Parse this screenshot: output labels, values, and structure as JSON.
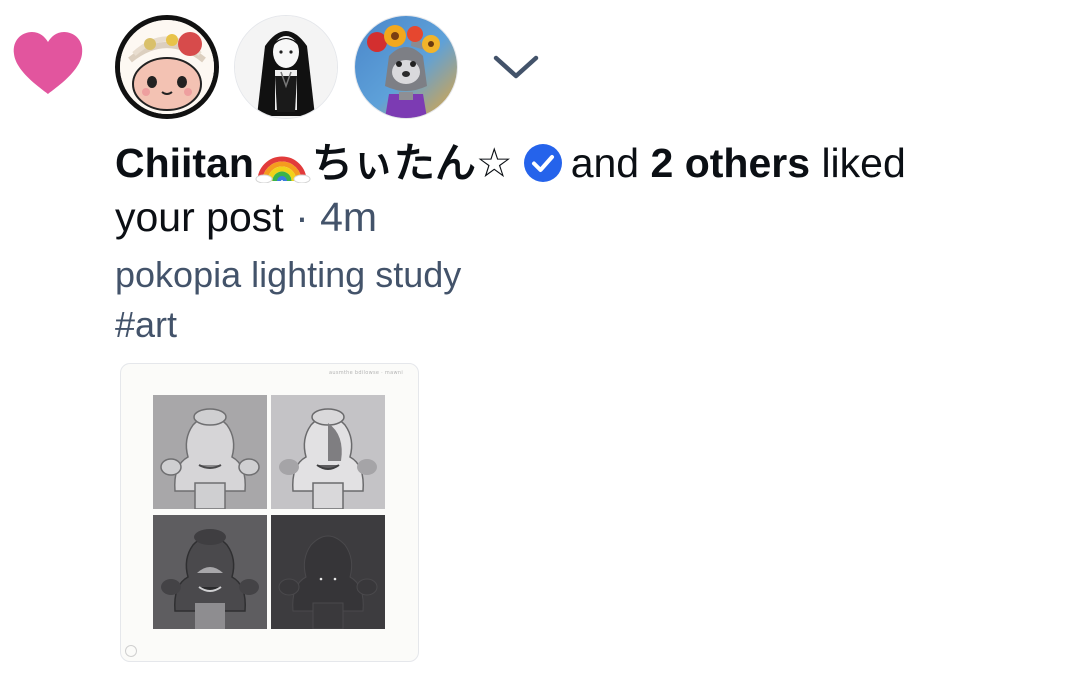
{
  "notification": {
    "type_icon": "heart-icon",
    "avatars": [
      {
        "name": "avatar-1",
        "icon": "pink-cat-avatar"
      },
      {
        "name": "avatar-2",
        "icon": "anime-girl-avatar"
      },
      {
        "name": "avatar-3",
        "icon": "flower-crown-wolf-avatar"
      }
    ],
    "expand_icon": "chevron-down-icon",
    "actor_name": "Chiitan",
    "actor_suffix": "ちぃたん☆",
    "actor_emoji": "rainbow",
    "actor_verified": true,
    "connector": "and",
    "others": "2 others",
    "action": "liked",
    "action_line2": "your post",
    "separator": "·",
    "time_ago": "4m",
    "post_text": "pokopia lighting study",
    "post_hashtag": "#art",
    "thumbnail_caption": "ausmthe bdilowse · mawni"
  },
  "colors": {
    "heart": "#e2559e",
    "verified": "#2563eb",
    "muted_text": "#43536a"
  }
}
